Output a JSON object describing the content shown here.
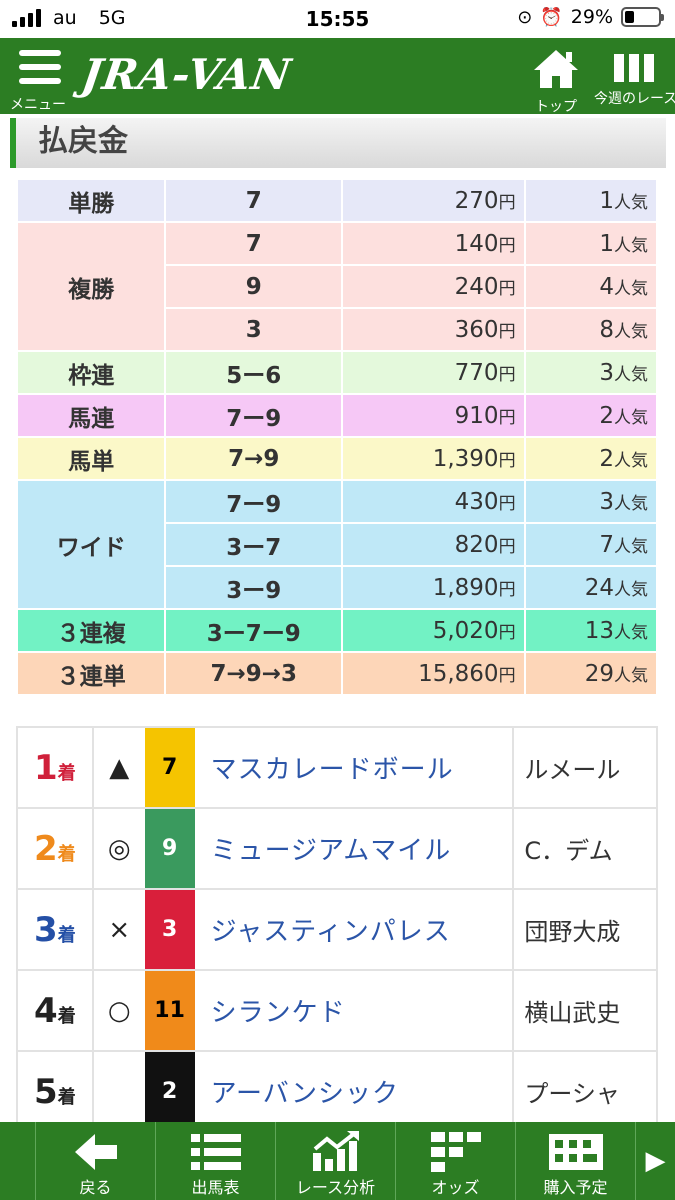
{
  "status_bar": {
    "carrier": "au",
    "network": "5G",
    "time": "15:55",
    "battery": "29%"
  },
  "header": {
    "menu_label": "メニュー",
    "logo": "JRA-VAN",
    "home_label": "トップ",
    "week_label": "今週のレース"
  },
  "section_title": "払戻金",
  "payout_unit": "円",
  "popularity_unit": "人気",
  "payouts": {
    "tansho": {
      "label": "単勝",
      "rows": [
        {
          "combo": "7",
          "amount": "270",
          "pop": "1"
        }
      ]
    },
    "fukusho": {
      "label": "複勝",
      "rows": [
        {
          "combo": "7",
          "amount": "140",
          "pop": "1"
        },
        {
          "combo": "9",
          "amount": "240",
          "pop": "4"
        },
        {
          "combo": "3",
          "amount": "360",
          "pop": "8"
        }
      ]
    },
    "wakuren": {
      "label": "枠連",
      "rows": [
        {
          "combo": "5ー6",
          "amount": "770",
          "pop": "3"
        }
      ]
    },
    "umaren": {
      "label": "馬連",
      "rows": [
        {
          "combo": "7ー9",
          "amount": "910",
          "pop": "2"
        }
      ]
    },
    "umatan": {
      "label": "馬単",
      "rows": [
        {
          "combo": "7→9",
          "amount": "1,390",
          "pop": "2"
        }
      ]
    },
    "wide": {
      "label": "ワイド",
      "rows": [
        {
          "combo": "7ー9",
          "amount": "430",
          "pop": "3"
        },
        {
          "combo": "3ー7",
          "amount": "820",
          "pop": "7"
        },
        {
          "combo": "3ー9",
          "amount": "1,890",
          "pop": "24"
        }
      ]
    },
    "sanrenpuku": {
      "label": "３連複",
      "rows": [
        {
          "combo": "3ー7ー9",
          "amount": "5,020",
          "pop": "13"
        }
      ]
    },
    "sanrentan": {
      "label": "３連単",
      "rows": [
        {
          "combo": "7→9→3",
          "amount": "15,860",
          "pop": "29"
        }
      ]
    }
  },
  "chaku_unit": "着",
  "results": [
    {
      "rank": "1",
      "mark": "▲",
      "number": "7",
      "horse": "マスカレードボール",
      "jockey": "ルメール",
      "rank_color": "#d0203a",
      "gate_color": "#f5c400",
      "gate_text_color": "#000000"
    },
    {
      "rank": "2",
      "mark": "◎",
      "number": "9",
      "horse": "ミュージアムマイル",
      "jockey": "C．デム",
      "rank_color": "#ef8a1c",
      "gate_color": "#3a9a5e",
      "gate_text_color": "#ffffff"
    },
    {
      "rank": "3",
      "mark": "×",
      "number": "3",
      "horse": "ジャスティンパレス",
      "jockey": "団野大成",
      "rank_color": "#244fa6",
      "gate_color": "#d91f3b",
      "gate_text_color": "#ffffff"
    },
    {
      "rank": "4",
      "mark": "○",
      "number": "11",
      "horse": "シランケド",
      "jockey": "横山武史",
      "rank_color": "#222222",
      "gate_color": "#f08a1a",
      "gate_text_color": "#000000"
    },
    {
      "rank": "5",
      "mark": "",
      "number": "2",
      "horse": "アーバンシック",
      "jockey": "プーシャ",
      "rank_color": "#222222",
      "gate_color": "#111111",
      "gate_text_color": "#ffffff"
    }
  ],
  "bottom_nav": [
    {
      "label": "戻る",
      "icon": "arrow-left-icon"
    },
    {
      "label": "出馬表",
      "icon": "list-icon"
    },
    {
      "label": "レース分析",
      "icon": "chart-icon"
    },
    {
      "label": "オッズ",
      "icon": "grid-icon"
    },
    {
      "label": "購入予定",
      "icon": "ticket-icon"
    }
  ]
}
